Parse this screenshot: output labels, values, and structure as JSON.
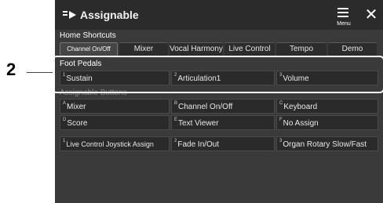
{
  "callout_number": "2",
  "header": {
    "title": "Assignable",
    "menu_label": "Menu",
    "close": "✕"
  },
  "home_shortcuts": {
    "label": "Home Shortcuts",
    "items": [
      "Channel On/Off",
      "Mixer",
      "Vocal Harmony",
      "Live Control",
      "Tempo",
      "Demo"
    ]
  },
  "foot_pedals": {
    "label": "Foot Pedals",
    "items": [
      {
        "num": "1",
        "label": "Sustain"
      },
      {
        "num": "2",
        "label": "Articulation1"
      },
      {
        "num": "3",
        "label": "Volume"
      }
    ]
  },
  "assignable_buttons": {
    "label": "Assignable Buttons",
    "items": [
      {
        "num": "A",
        "label": "Mixer"
      },
      {
        "num": "B",
        "label": "Channel On/Off"
      },
      {
        "num": "C",
        "label": "Keyboard"
      },
      {
        "num": "D",
        "label": "Score"
      },
      {
        "num": "E",
        "label": "Text Viewer"
      },
      {
        "num": "F",
        "label": "No Assign"
      }
    ]
  },
  "live_control": {
    "items": [
      {
        "num": "1",
        "label": "Live Control Joystick Assign"
      },
      {
        "num": "2",
        "label": "Fade In/Out"
      },
      {
        "num": "3",
        "label": "Organ Rotary Slow/Fast"
      }
    ]
  }
}
